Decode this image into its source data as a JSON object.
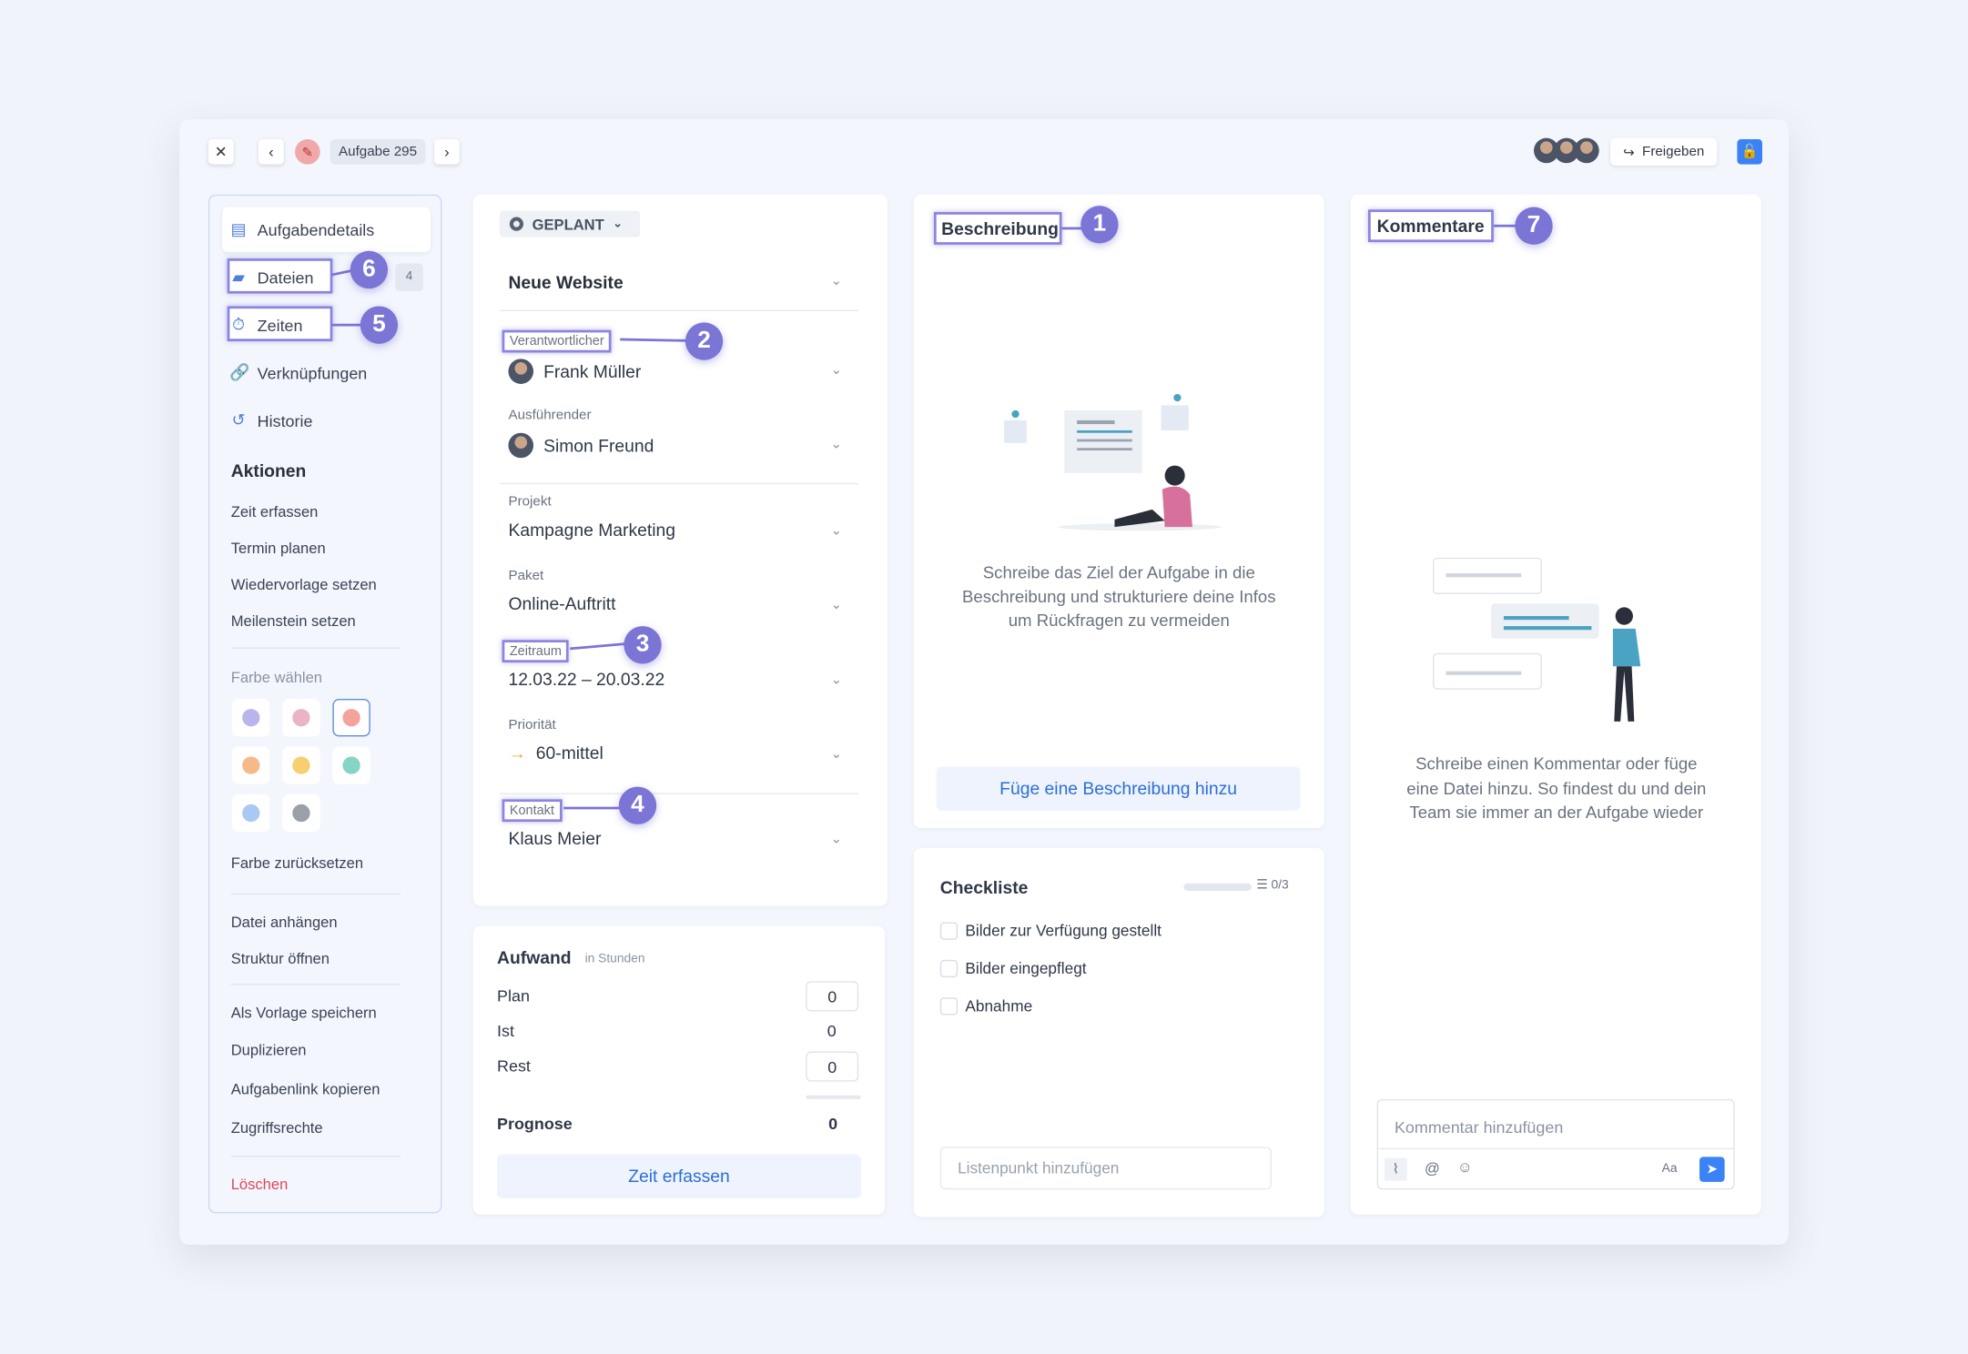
{
  "header": {
    "task_label": "Aufgabe 295",
    "share_label": "Freigeben"
  },
  "sidebar": {
    "items": [
      {
        "label": "Aufgabendetails"
      },
      {
        "label": "Dateien",
        "count": "4"
      },
      {
        "label": "Zeiten"
      },
      {
        "label": "Verknüpfungen"
      },
      {
        "label": "Historie"
      }
    ],
    "actions_title": "Aktionen",
    "actions": [
      "Zeit erfassen",
      "Termin planen",
      "Wiedervorlage setzen",
      "Meilenstein setzen"
    ],
    "color_title": "Farbe wählen",
    "colors": [
      "#b9b4ec",
      "#eab4c4",
      "#f3a39c",
      "#f6b98a",
      "#f8cf6e",
      "#86d4c4",
      "#a9c9f4",
      "#9a9fa8"
    ],
    "color_reset": "Farbe zurücksetzen",
    "more_actions": [
      "Datei anhängen",
      "Struktur öffnen"
    ],
    "more_actions2": [
      "Als Vorlage speichern",
      "Duplizieren",
      "Aufgabenlink kopieren",
      "Zugriffsrechte"
    ],
    "delete": "Löschen"
  },
  "details": {
    "status": "GEPLANT",
    "title": "Neue Website",
    "fields": [
      {
        "label": "Verantwortlicher",
        "value": "Frank Müller"
      },
      {
        "label": "Ausführender",
        "value": "Simon Freund"
      },
      {
        "label": "Projekt",
        "value": "Kampagne Marketing"
      },
      {
        "label": "Paket",
        "value": "Online-Auftritt"
      },
      {
        "label": "Zeitraum",
        "value": "12.03.22 – 20.03.22"
      },
      {
        "label": "Priorität",
        "value": "60-mittel"
      },
      {
        "label": "Kontakt",
        "value": "Klaus Meier"
      }
    ]
  },
  "effort": {
    "title": "Aufwand",
    "unit": "in Stunden",
    "rows": [
      {
        "label": "Plan",
        "value": "0"
      },
      {
        "label": "Ist",
        "value": "0"
      },
      {
        "label": "Rest",
        "value": "0"
      }
    ],
    "forecast_label": "Prognose",
    "forecast_value": "0",
    "button": "Zeit erfassen"
  },
  "description": {
    "title": "Beschreibung",
    "empty_text": "Schreibe das Ziel der Aufgabe in die Beschreibung und strukturiere deine Infos um Rückfragen zu vermeiden",
    "button": "Füge eine Beschreibung hinzu"
  },
  "checklist": {
    "title": "Checkliste",
    "progress": "0/3",
    "progress_fraction": 0,
    "items": [
      "Bilder zur Verfügung gestellt",
      "Bilder eingepflegt",
      "Abnahme"
    ],
    "placeholder": "Listenpunkt hinzufügen"
  },
  "comments": {
    "title": "Kommentare",
    "empty_text": "Schreibe einen Kommentar oder füge eine Datei hinzu. So findest du und dein Team sie immer an der Aufgabe wieder",
    "placeholder": "Kommentar hinzufügen",
    "format_label": "Aa"
  },
  "annotations": [
    "1",
    "2",
    "3",
    "4",
    "5",
    "6",
    "7"
  ],
  "accent": "#7b75d6",
  "primary": "#3b82f6"
}
